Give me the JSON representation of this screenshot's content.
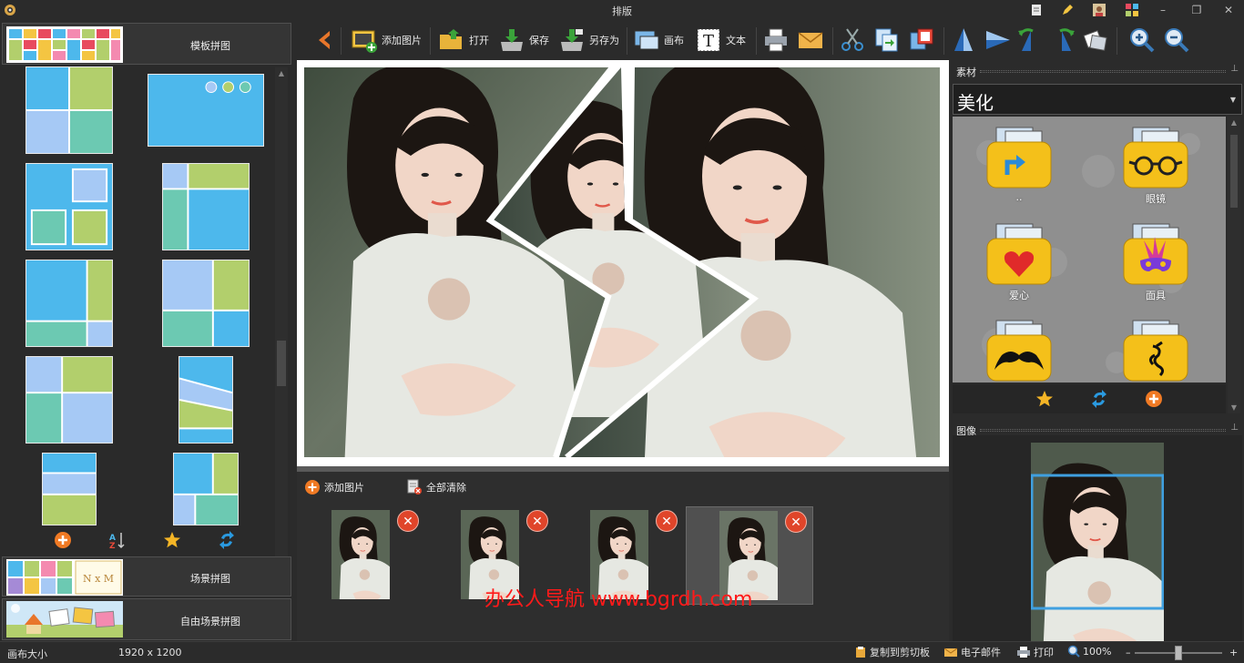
{
  "window": {
    "title": "排版",
    "controls": {
      "minimize": "–",
      "maximize": "❐",
      "close": "✕"
    }
  },
  "toolbar": {
    "back_icon": "chevron-left-icon",
    "add_image": "添加图片",
    "open": "打开",
    "save": "保存",
    "save_as": "另存为",
    "canvas": "画布",
    "text": "文本"
  },
  "left_panel": {
    "template_group": "模板拼图",
    "scene_group": "场景拼图",
    "free_scene_group": "自由场景拼图",
    "scene_thumb_text": "N x M"
  },
  "image_list": {
    "add_image": "添加图片",
    "clear_all": "全部清除",
    "thumbnail_count": 4,
    "selected_index": 3
  },
  "right_panel": {
    "materials_title": "素材",
    "category": "美化",
    "assets": [
      {
        "label": "..",
        "icon": "arrow-up-folder-icon"
      },
      {
        "label": "眼镜",
        "icon": "glasses-folder-icon"
      },
      {
        "label": "爱心",
        "icon": "heart-folder-icon"
      },
      {
        "label": "面具",
        "icon": "mask-folder-icon"
      },
      {
        "label": "",
        "icon": "mustache-folder-icon"
      },
      {
        "label": "",
        "icon": "dragon-folder-icon"
      }
    ],
    "image_title": "图像"
  },
  "watermark": "办公人导航 www.bgrdh.com",
  "status": {
    "canvas_size_label": "画布大小",
    "canvas_size_value": "1920 x 1200",
    "copy_clipboard": "复制到剪切板",
    "email": "电子邮件",
    "print": "打印",
    "zoom": "100%",
    "zoom_minus": "–",
    "zoom_plus": "+",
    "zoom_slider_fraction": 0.5
  },
  "colors": {
    "template_blue": "#4db8ec",
    "template_green": "#b2cf6c",
    "template_teal": "#6cc9b2",
    "template_lightblue": "#a6c9f5",
    "selection_blue": "#3fa0e0",
    "delete_red": "#e0452a",
    "watermark_red": "#ff1a1a"
  }
}
